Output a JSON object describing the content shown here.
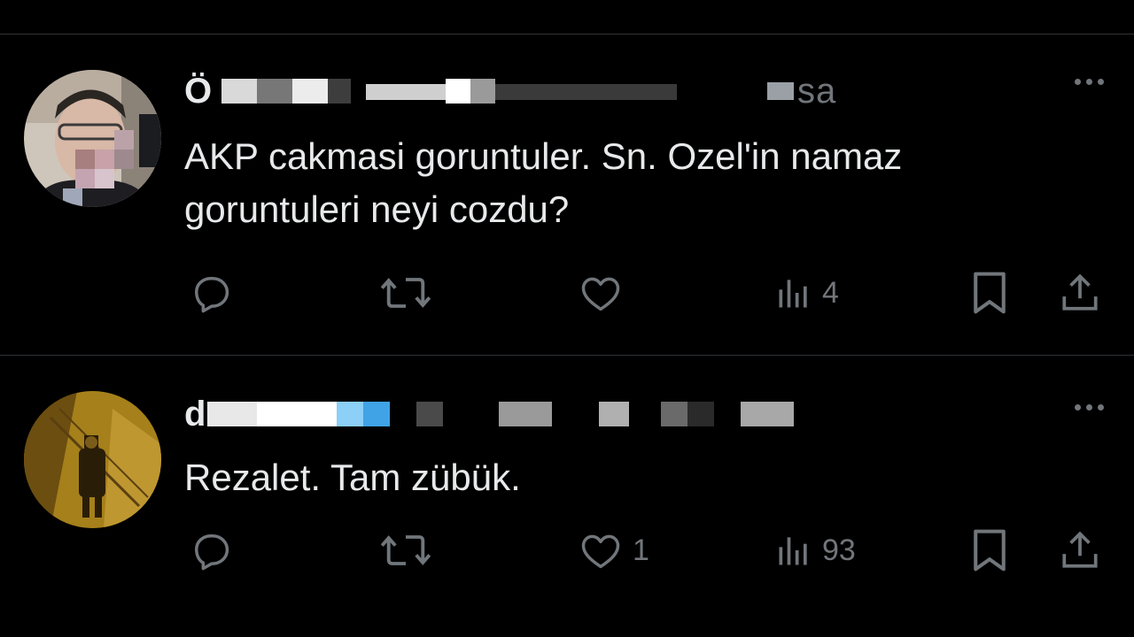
{
  "tweets": [
    {
      "author_display_redacted": "Ö",
      "handle_tail": "sa",
      "text": "AKP cakmasi goruntuler. Sn. Ozel'in namaz\ngoruntuleri neyi cozdu?",
      "avatar": "man-with-glasses-photo",
      "actions": {
        "reply_count": "",
        "retweet_count": "",
        "like_count": "",
        "views_count": "4"
      }
    },
    {
      "author_display_redacted": "d",
      "handle_tail": "",
      "text": "Rezalet. Tam zübük.",
      "avatar": "sepia-figure-on-staircase-photo",
      "actions": {
        "reply_count": "",
        "retweet_count": "",
        "like_count": "1",
        "views_count": "93"
      }
    }
  ],
  "icons": {
    "reply": "reply-bubble-icon",
    "retweet": "retweet-arrows-icon",
    "like": "heart-icon",
    "views": "views-bar-chart-icon",
    "bookmark": "bookmark-icon",
    "share": "share-upload-icon",
    "more": "more-dots-icon"
  },
  "colors": {
    "background": "#000000",
    "text": "#e7e9ea",
    "secondary": "#71767b",
    "divider": "#2f3336"
  }
}
